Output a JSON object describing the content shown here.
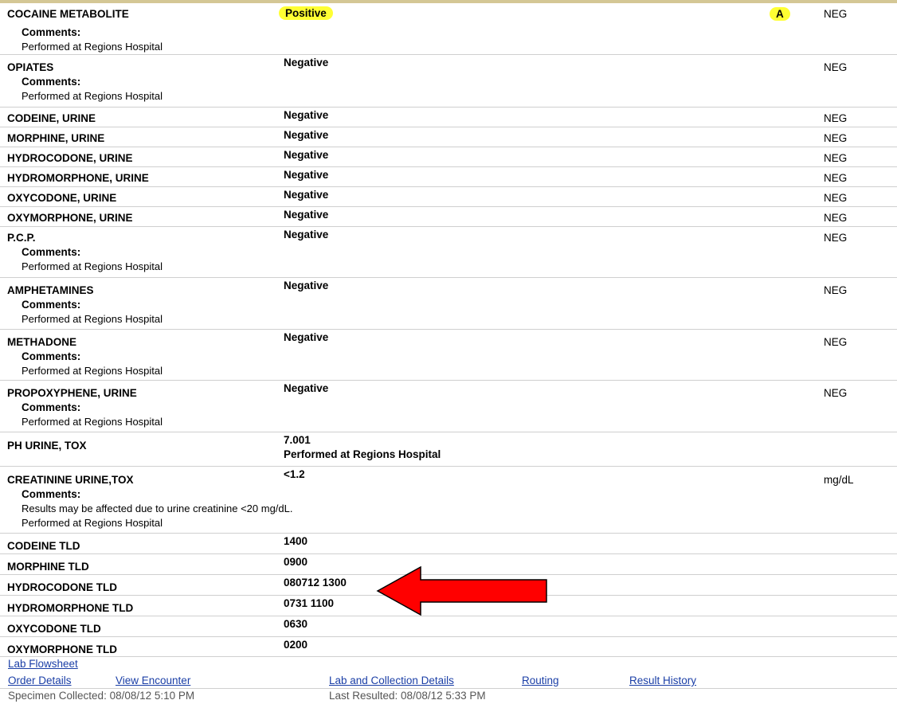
{
  "colors": {
    "highlight": "#ffff33",
    "arrow": "#ff0000",
    "link": "#1a3ea6"
  },
  "comments_label": "Comments:",
  "performed_note": "Performed at Regions Hospital",
  "rows": [
    {
      "test": "COCAINE METABOLITE",
      "result": "Positive",
      "flag": "A",
      "ref": "NEG"
    },
    {
      "test": "OPIATES",
      "result": "Negative",
      "ref": "NEG"
    },
    {
      "test": "CODEINE, URINE",
      "result": "Negative",
      "ref": "NEG"
    },
    {
      "test": "MORPHINE, URINE",
      "result": "Negative",
      "ref": "NEG"
    },
    {
      "test": "HYDROCODONE, URINE",
      "result": "Negative",
      "ref": "NEG"
    },
    {
      "test": "HYDROMORPHONE, URINE",
      "result": "Negative",
      "ref": "NEG"
    },
    {
      "test": "OXYCODONE, URINE",
      "result": "Negative",
      "ref": "NEG"
    },
    {
      "test": "OXYMORPHONE, URINE",
      "result": "Negative",
      "ref": "NEG"
    },
    {
      "test": "P.C.P.",
      "result": "Negative",
      "ref": "NEG"
    },
    {
      "test": "AMPHETAMINES",
      "result": "Negative",
      "ref": "NEG"
    },
    {
      "test": "METHADONE",
      "result": "Negative",
      "ref": "NEG"
    },
    {
      "test": "PROPOXYPHENE, URINE",
      "result": "Negative",
      "ref": "NEG"
    },
    {
      "test": "PH URINE, TOX",
      "result": "7.001",
      "sub": "Performed at Regions Hospital"
    },
    {
      "test": "CREATININE URINE,TOX",
      "result": "<1.2",
      "ref": "mg/dL",
      "comment": "Results may be affected due to urine creatinine <20 mg/dL."
    },
    {
      "test": "CODEINE TLD",
      "result": "1400"
    },
    {
      "test": "MORPHINE TLD",
      "result": "0900"
    },
    {
      "test": "HYDROCODONE TLD",
      "result": "080712 1300"
    },
    {
      "test": "HYDROMORPHONE TLD",
      "result": "0731 1100"
    },
    {
      "test": "OXYCODONE TLD",
      "result": "0630"
    },
    {
      "test": "OXYMORPHONE TLD",
      "result": "0200"
    }
  ],
  "links": {
    "lab_flowsheet": "Lab Flowsheet",
    "order_details": "Order Details",
    "view_encounter": "View Encounter",
    "lab_collection": "Lab and Collection Details",
    "routing": "Routing",
    "result_history": "Result History"
  },
  "footer": {
    "specimen_collected": "Specimen Collected: 08/08/12  5:10 PM",
    "last_resulted": "Last Resulted: 08/08/12  5:33 PM"
  }
}
